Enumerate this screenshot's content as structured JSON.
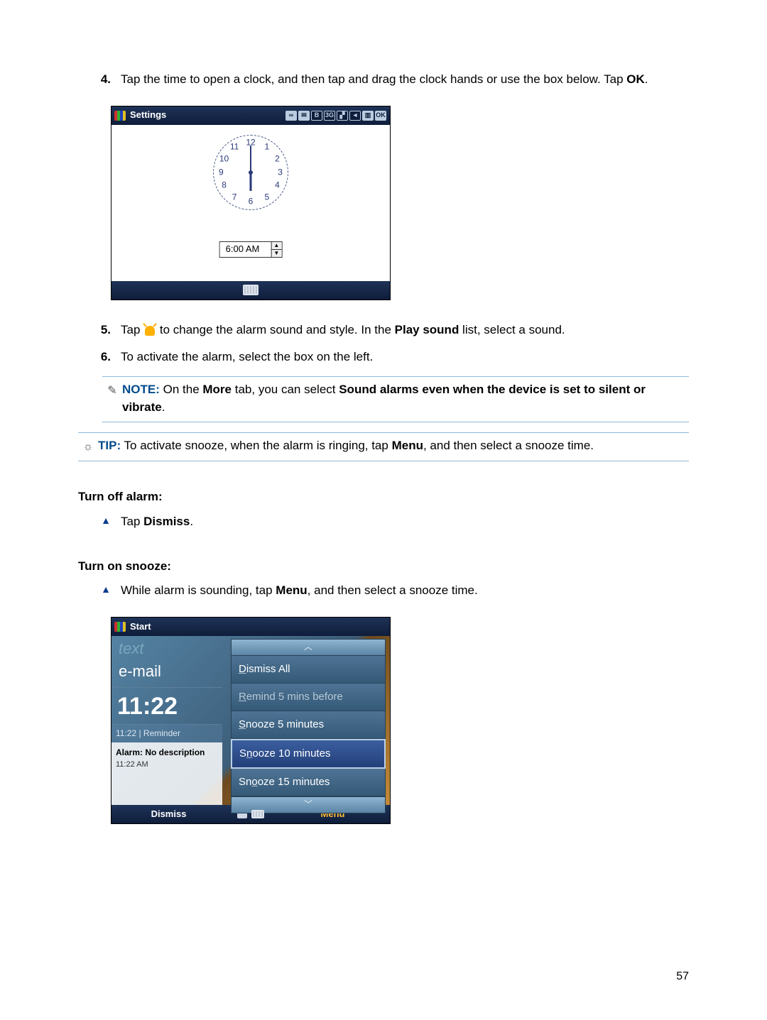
{
  "items": {
    "i4": {
      "num": "4.",
      "text_a": "Tap the time to open a clock, and then tap and drag the clock hands or use the box below. Tap ",
      "text_b": "OK",
      "text_c": "."
    },
    "i5": {
      "num": "5.",
      "text_a": "Tap ",
      "text_b": " to change the alarm sound and style. In the ",
      "bold_b": "Play sound",
      "text_c": " list, select a sound."
    },
    "i6": {
      "num": "6.",
      "text": "To activate the alarm, select the box on the left."
    }
  },
  "note": {
    "label": "NOTE:",
    "a": "On the ",
    "b1": "More",
    "c": " tab, you can select ",
    "b2": "Sound alarms even when the device is set to silent or vibrate",
    "d": "."
  },
  "tip": {
    "label": "TIP:",
    "a": "To activate snooze, when the alarm is ringing, tap ",
    "b1": "Menu",
    "c": ", and then select a snooze time."
  },
  "turn_off": {
    "title": "Turn off alarm:",
    "a": "Tap ",
    "b": "Dismiss",
    "c": "."
  },
  "turn_on": {
    "title": "Turn on snooze:",
    "a": "While alarm is sounding, tap ",
    "b": "Menu",
    "c": ", and then select a snooze time."
  },
  "shot1": {
    "title": "Settings",
    "status_icons": [
      "∞",
      "✉",
      "B",
      "3G",
      "▞",
      "◄",
      "▥",
      "OK"
    ],
    "clock_nums": [
      "12",
      "1",
      "2",
      "3",
      "4",
      "5",
      "6",
      "7",
      "8",
      "9",
      "10",
      "11"
    ],
    "time": "6:00 AM"
  },
  "shot2": {
    "title": "Start",
    "left": {
      "text": "text",
      "email": "e-mail",
      "bigtime": "11:22",
      "reminder": "11:22 | Reminder",
      "alarm_t1": "Alarm: No description",
      "alarm_t2": "11:22 AM"
    },
    "menu": {
      "up": "︿",
      "items": [
        {
          "label": "Dismiss All",
          "u": "D",
          "rest": "ismiss All"
        },
        {
          "label": "Remind 5 mins before",
          "u": "R",
          "rest": "emind 5 mins before",
          "disabled": true
        },
        {
          "label": "Snooze 5 minutes",
          "u": "S",
          "rest": "nooze 5 minutes"
        },
        {
          "label": "Snooze 10 minutes",
          "u": "n",
          "pre": "S",
          "rest": "ooze 10 minutes",
          "selected": true
        },
        {
          "label": "Snooze 15 minutes",
          "u": "o",
          "pre": "Sn",
          "rest": "oze 15 minutes"
        }
      ],
      "down": "﹀"
    },
    "softkeys": {
      "left": "Dismiss",
      "right": "Menu"
    }
  },
  "page_number": "57"
}
